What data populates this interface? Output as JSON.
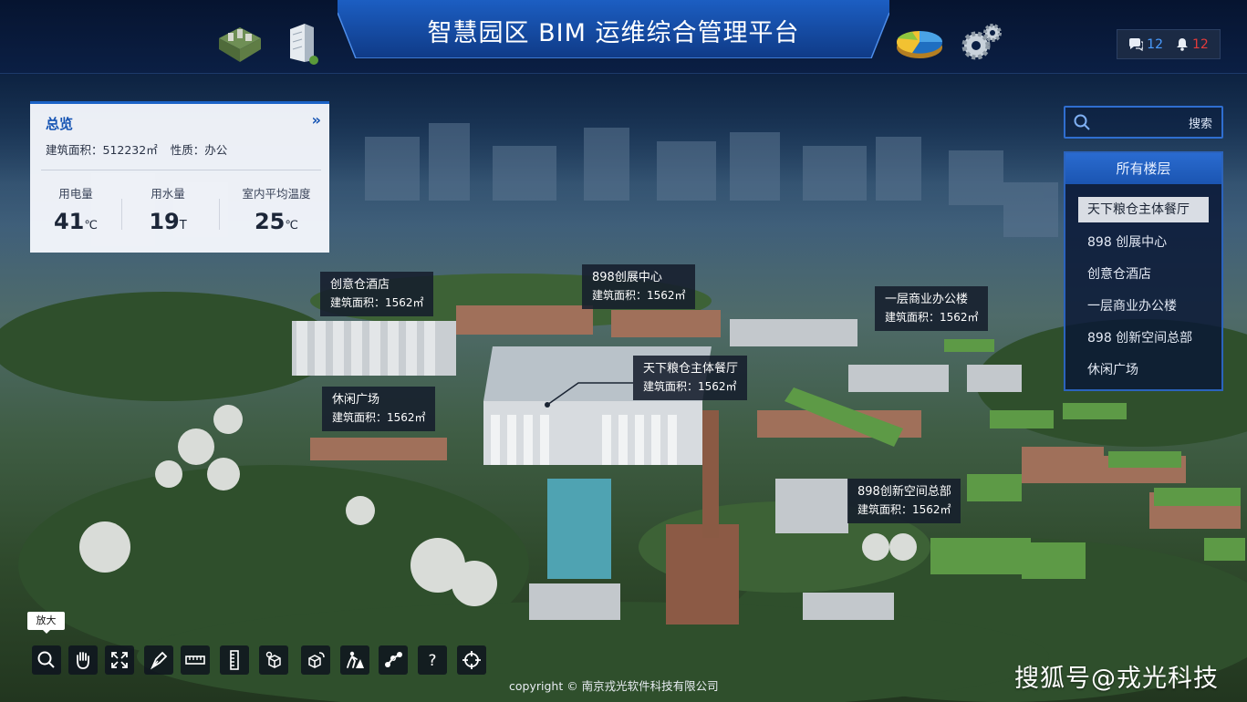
{
  "header": {
    "title": "智慧园区 BIM 运维综合管理平台",
    "icons": [
      "park-model-icon",
      "building-icon",
      "pie-chart-icon",
      "gears-icon"
    ],
    "messages": {
      "count": "12",
      "icon": "chat-icon"
    },
    "alarms": {
      "count": "12",
      "icon": "bell-icon",
      "color": "#e23b3b"
    }
  },
  "overview": {
    "title": "总览",
    "area_text": "建筑面积：512232㎡",
    "nature_text": "性质：办公",
    "stats": [
      {
        "label": "用电量",
        "value": "41",
        "unit": "℃"
      },
      {
        "label": "用水量",
        "value": "19",
        "unit": "T"
      },
      {
        "label": "室内平均温度",
        "value": "25",
        "unit": "℃"
      }
    ]
  },
  "search": {
    "button_label": "搜索",
    "placeholder": ""
  },
  "floors": {
    "title": "所有楼层",
    "items": [
      "天下粮仓主体餐厅",
      "898 创展中心",
      "创意仓酒店",
      "一层商业办公楼",
      "898 创新空间总部",
      "休闲广场"
    ],
    "active_index": 0
  },
  "map_labels": [
    {
      "name": "创意仓酒店",
      "area": "建筑面积：1562㎡"
    },
    {
      "name": "898创展中心",
      "area": "建筑面积：1562㎡"
    },
    {
      "name": "一层商业办公楼",
      "area": "建筑面积：1562㎡"
    },
    {
      "name": "天下粮仓主体餐厅",
      "area": "建筑面积：1562㎡"
    },
    {
      "name": "休闲广场",
      "area": "建筑面积：1562㎡"
    },
    {
      "name": "898创新空间总部",
      "area": "建筑面积：1562㎡"
    }
  ],
  "toolbar": {
    "tooltip": "放大",
    "tools": [
      "zoom-icon",
      "pan-hand-icon",
      "fullscreen-icon",
      "draw-pen-icon",
      "ruler-icon",
      "vertical-ruler-icon",
      "cube-section-icon",
      "cube-rotate-icon",
      "roam-person-icon",
      "route-icon",
      "help-icon",
      "locate-icon"
    ]
  },
  "footer": {
    "copyright": "copyright © 南京戎光软件科技有限公司",
    "watermark": "搜狐号@戎光科技"
  },
  "colors": {
    "accent": "#1b62c6",
    "panel": "#f5f7fc",
    "alarm": "#e23b3b",
    "msg": "#4a9cff"
  }
}
